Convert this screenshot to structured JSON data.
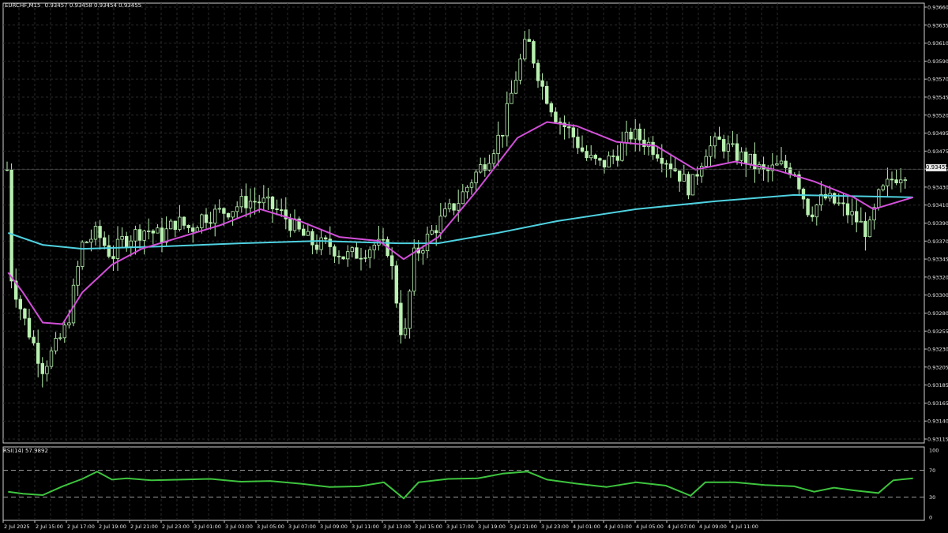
{
  "header": {
    "symbol": "EURCHF,M15",
    "ohlc": "0.93457 0.93458 0.93454 0.93455"
  },
  "price_axis": {
    "ticks": [
      "0.93660",
      "0.93635",
      "0.93610",
      "0.93590",
      "0.93570",
      "0.93545",
      "0.93520",
      "0.93495",
      "0.93475",
      "0.93455",
      "0.93430",
      "0.93410",
      "0.93390",
      "0.93370",
      "0.93345",
      "0.93320",
      "0.93300",
      "0.93280",
      "0.93255",
      "0.93230",
      "0.93205",
      "0.93185",
      "0.93165",
      "0.93140",
      "0.93115"
    ],
    "current_price_tag": "0.93455"
  },
  "rsi_panel": {
    "label": "RSI(14) 57.9892",
    "levels": [
      "100",
      "70",
      "30",
      "0"
    ]
  },
  "time_axis": {
    "ticks": [
      "2 Jul 2025",
      "2 Jul 15:00",
      "2 Jul 17:00",
      "2 Jul 19:00",
      "2 Jul 21:00",
      "2 Jul 23:00",
      "3 Jul 01:00",
      "3 Jul 03:00",
      "3 Jul 05:00",
      "3 Jul 07:00",
      "3 Jul 09:00",
      "3 Jul 11:00",
      "3 Jul 13:00",
      "3 Jul 15:00",
      "3 Jul 17:00",
      "3 Jul 19:00",
      "3 Jul 21:00",
      "3 Jul 23:00",
      "4 Jul 01:00",
      "4 Jul 03:00",
      "4 Jul 05:00",
      "4 Jul 07:00",
      "4 Jul 09:00",
      "4 Jul 11:00"
    ]
  },
  "colors": {
    "background": "#000000",
    "grid": "#2a2a2a",
    "candle": "#b8f0b0",
    "candle_body_up": "#000000",
    "ma_fast": "#d24fd9",
    "ma_slow": "#4fd1e0",
    "rsi": "#3ec43e",
    "axis_text": "#e8e8e8"
  },
  "chart_data": [
    {
      "type": "candlestick",
      "title": "EURCHF,M15",
      "ylim": [
        0.93115,
        0.9366
      ],
      "close_path": [
        [
          "2 Jul 2025 13:15",
          0.93335
        ],
        [
          "2 Jul 2025 14:00",
          0.9327
        ],
        [
          "2 Jul 2025 15:00",
          0.93205
        ],
        [
          "2 Jul 2025 15:45",
          0.93235
        ],
        [
          "2 Jul 2025 16:15",
          0.9326
        ],
        [
          "2 Jul 2025 17:00",
          0.9336
        ],
        [
          "2 Jul 2025 17:45",
          0.93375
        ],
        [
          "2 Jul 2025 18:30",
          0.93345
        ],
        [
          "2 Jul 2025 19:00",
          0.93365
        ],
        [
          "2 Jul 2025 19:45",
          0.93375
        ],
        [
          "2 Jul 2025 20:15",
          0.9338
        ],
        [
          "2 Jul 2025 21:00",
          0.9337
        ],
        [
          "2 Jul 2025 21:45",
          0.9339
        ],
        [
          "2 Jul 2025 22:30",
          0.9338
        ],
        [
          "2 Jul 2025 23:00",
          0.93395
        ],
        [
          "2 Jul 2025 23:45",
          0.934
        ],
        [
          "3 Jul 2025 00:30",
          0.93405
        ],
        [
          "3 Jul 2025 01:15",
          0.93415
        ],
        [
          "3 Jul 2025 02:00",
          0.93415
        ],
        [
          "3 Jul 2025 02:45",
          0.93405
        ],
        [
          "3 Jul 2025 03:15",
          0.93395
        ],
        [
          "3 Jul 2025 04:00",
          0.93375
        ],
        [
          "3 Jul 2025 04:45",
          0.9336
        ],
        [
          "3 Jul 2025 05:30",
          0.9336
        ],
        [
          "3 Jul 2025 06:15",
          0.93345
        ],
        [
          "3 Jul 2025 07:00",
          0.9335
        ],
        [
          "3 Jul 2025 07:45",
          0.9336
        ],
        [
          "3 Jul 2025 08:30",
          0.93355
        ],
        [
          "3 Jul 2025 09:15",
          0.9323
        ],
        [
          "3 Jul 2025 09:45",
          0.93345
        ],
        [
          "3 Jul 2025 10:30",
          0.9337
        ],
        [
          "3 Jul 2025 11:15",
          0.93395
        ],
        [
          "3 Jul 2025 12:00",
          0.93415
        ],
        [
          "3 Jul 2025 12:45",
          0.93445
        ],
        [
          "3 Jul 2025 13:30",
          0.9347
        ],
        [
          "3 Jul 2025 14:15",
          0.93505
        ],
        [
          "3 Jul 2025 15:00",
          0.9358
        ],
        [
          "3 Jul 2025 15:30",
          0.9362
        ],
        [
          "3 Jul 2025 16:15",
          0.9356
        ],
        [
          "3 Jul 2025 17:00",
          0.9352
        ],
        [
          "3 Jul 2025 17:45",
          0.935
        ],
        [
          "3 Jul 2025 18:30",
          0.9347
        ],
        [
          "3 Jul 2025 19:15",
          0.9346
        ],
        [
          "3 Jul 2025 20:00",
          0.93475
        ],
        [
          "3 Jul 2025 20:45",
          0.935
        ],
        [
          "3 Jul 2025 21:30",
          0.9349
        ],
        [
          "3 Jul 2025 22:15",
          0.93475
        ],
        [
          "3 Jul 2025 23:00",
          0.93455
        ],
        [
          "3 Jul 2025 23:45",
          0.9343
        ],
        [
          "4 Jul 2025 00:30",
          0.9348
        ],
        [
          "4 Jul 2025 01:15",
          0.9349
        ],
        [
          "4 Jul 2025 02:00",
          0.93475
        ],
        [
          "4 Jul 2025 02:45",
          0.93465
        ],
        [
          "4 Jul 2025 03:30",
          0.9345
        ],
        [
          "4 Jul 2025 04:15",
          0.9346
        ],
        [
          "4 Jul 2025 05:00",
          0.93455
        ],
        [
          "4 Jul 2025 05:45",
          0.934
        ],
        [
          "4 Jul 2025 06:30",
          0.9342
        ],
        [
          "4 Jul 2025 07:15",
          0.9341
        ],
        [
          "4 Jul 2025 08:00",
          0.93395
        ],
        [
          "4 Jul 2025 08:45",
          0.93375
        ],
        [
          "4 Jul 2025 09:15",
          0.9342
        ],
        [
          "4 Jul 2025 10:00",
          0.93445
        ],
        [
          "4 Jul 2025 10:45",
          0.93455
        ]
      ],
      "series": [
        {
          "name": "ma_fast",
          "points": [
            [
              "2 Jul 2025 13:15",
              0.93325
            ],
            [
              "2 Jul 2025 14:00",
              0.933
            ],
            [
              "2 Jul 2025 15:00",
              0.93262
            ],
            [
              "2 Jul 2025 16:00",
              0.9326
            ],
            [
              "2 Jul 2025 17:00",
              0.933
            ],
            [
              "2 Jul 2025 18:30",
              0.93335
            ],
            [
              "2 Jul 2025 20:00",
              0.93355
            ],
            [
              "2 Jul 2025 22:00",
              0.9337
            ],
            [
              "3 Jul 2025 00:00",
              0.93385
            ],
            [
              "3 Jul 2025 02:00",
              0.93405
            ],
            [
              "3 Jul 2025 04:00",
              0.9339
            ],
            [
              "3 Jul 2025 06:00",
              0.9337
            ],
            [
              "3 Jul 2025 08:00",
              0.93365
            ],
            [
              "3 Jul 2025 09:15",
              0.93342
            ],
            [
              "3 Jul 2025 11:00",
              0.9337
            ],
            [
              "3 Jul 2025 13:00",
              0.9343
            ],
            [
              "3 Jul 2025 15:00",
              0.93495
            ],
            [
              "3 Jul 2025 16:30",
              0.93515
            ],
            [
              "3 Jul 2025 18:00",
              0.9351
            ],
            [
              "3 Jul 2025 20:00",
              0.9349
            ],
            [
              "3 Jul 2025 22:00",
              0.93485
            ],
            [
              "4 Jul 2025 00:00",
              0.93455
            ],
            [
              "4 Jul 2025 02:00",
              0.93465
            ],
            [
              "4 Jul 2025 04:00",
              0.93455
            ],
            [
              "4 Jul 2025 06:00",
              0.9344
            ],
            [
              "4 Jul 2025 08:00",
              0.9342
            ],
            [
              "4 Jul 2025 09:00",
              0.93405
            ],
            [
              "4 Jul 2025 11:00",
              0.9342
            ]
          ]
        },
        {
          "name": "ma_slow",
          "points": [
            [
              "2 Jul 2025 13:15",
              0.93375
            ],
            [
              "2 Jul 2025 15:00",
              0.9336
            ],
            [
              "2 Jul 2025 17:00",
              0.93355
            ],
            [
              "2 Jul 2025 21:00",
              0.93358
            ],
            [
              "3 Jul 2025 01:00",
              0.93362
            ],
            [
              "3 Jul 2025 05:00",
              0.93365
            ],
            [
              "3 Jul 2025 09:00",
              0.93362
            ],
            [
              "3 Jul 2025 11:00",
              0.93362
            ],
            [
              "3 Jul 2025 14:00",
              0.93375
            ],
            [
              "3 Jul 2025 17:00",
              0.9339
            ],
            [
              "3 Jul 2025 21:00",
              0.93405
            ],
            [
              "4 Jul 2025 01:00",
              0.93415
            ],
            [
              "4 Jul 2025 05:00",
              0.93423
            ],
            [
              "4 Jul 2025 11:00",
              0.9342
            ]
          ]
        }
      ]
    },
    {
      "type": "line",
      "title": "RSI(14) 57.9892",
      "ylim": [
        0,
        100
      ],
      "levels": [
        70,
        30
      ],
      "series": [
        {
          "name": "RSI(14)",
          "points": [
            [
              "2 Jul 2025 13:15",
              38
            ],
            [
              "2 Jul 2025 14:00",
              35
            ],
            [
              "2 Jul 2025 15:00",
              33
            ],
            [
              "2 Jul 2025 16:00",
              46
            ],
            [
              "2 Jul 2025 17:00",
              57
            ],
            [
              "2 Jul 2025 17:45",
              68
            ],
            [
              "2 Jul 2025 18:30",
              56
            ],
            [
              "2 Jul 2025 19:15",
              58
            ],
            [
              "2 Jul 2025 20:30",
              55
            ],
            [
              "2 Jul 2025 22:00",
              56
            ],
            [
              "2 Jul 2025 23:30",
              57
            ],
            [
              "3 Jul 2025 01:00",
              53
            ],
            [
              "3 Jul 2025 02:30",
              54
            ],
            [
              "3 Jul 2025 04:00",
              50
            ],
            [
              "3 Jul 2025 05:30",
              45
            ],
            [
              "3 Jul 2025 07:00",
              46
            ],
            [
              "3 Jul 2025 08:15",
              52
            ],
            [
              "3 Jul 2025 09:15",
              28
            ],
            [
              "3 Jul 2025 10:00",
              52
            ],
            [
              "3 Jul 2025 11:30",
              57
            ],
            [
              "3 Jul 2025 13:00",
              58
            ],
            [
              "3 Jul 2025 14:15",
              65
            ],
            [
              "3 Jul 2025 15:30",
              68
            ],
            [
              "3 Jul 2025 16:30",
              56
            ],
            [
              "3 Jul 2025 18:00",
              50
            ],
            [
              "3 Jul 2025 19:30",
              45
            ],
            [
              "3 Jul 2025 21:00",
              52
            ],
            [
              "3 Jul 2025 22:30",
              47
            ],
            [
              "3 Jul 2025 23:45",
              32
            ],
            [
              "4 Jul 2025 00:30",
              52
            ],
            [
              "4 Jul 2025 02:00",
              52
            ],
            [
              "4 Jul 2025 03:30",
              48
            ],
            [
              "4 Jul 2025 05:00",
              46
            ],
            [
              "4 Jul 2025 06:00",
              38
            ],
            [
              "4 Jul 2025 07:00",
              44
            ],
            [
              "4 Jul 2025 08:00",
              40
            ],
            [
              "4 Jul 2025 09:15",
              36
            ],
            [
              "4 Jul 2025 10:00",
              55
            ],
            [
              "4 Jul 2025 11:00",
              58
            ]
          ]
        }
      ]
    }
  ]
}
